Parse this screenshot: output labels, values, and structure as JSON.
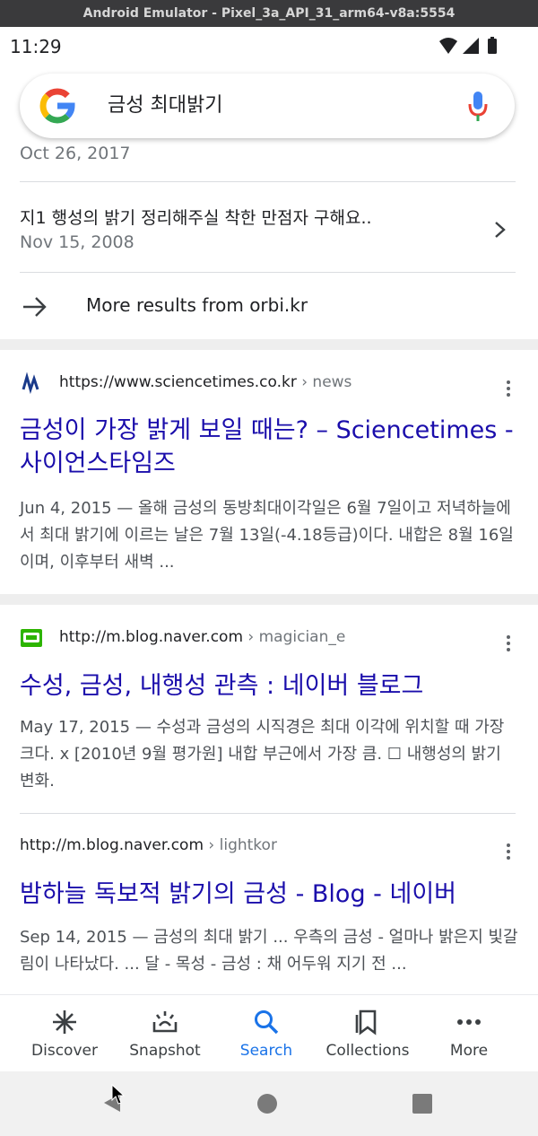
{
  "window": {
    "title": "Android Emulator - Pixel_3a_API_31_arm64-v8a:5554"
  },
  "status": {
    "time": "11:29"
  },
  "search": {
    "query": "금성 최대밝기"
  },
  "orbi": {
    "top_date": "Oct 26, 2017",
    "sub_title": "지1 행성의 밝기 정리해주실 착한 만점자 구해요..",
    "sub_date": "Nov 15, 2008",
    "more_results": "More results from orbi.kr"
  },
  "results": [
    {
      "url": "https://www.sciencetimes.co.kr",
      "crumb": " › news",
      "title": "금성이 가장 밝게 보일 때는? – Sciencetimes - 사이언스타임즈",
      "snippet": "Jun 4, 2015 — 올해 금성의 동방최대이각일은 6월 7일이고 저녁하늘에서 최대 밝기에 이르는 날은 7월 13일(-4.18등급)이다. 내합은 8월 16일이며, 이후부터 새벽 ..."
    },
    {
      "url": "http://m.blog.naver.com",
      "crumb": " › magician_e",
      "title": "수성, 금성, 내행성 관측 : 네이버 블로그",
      "snippet": "May 17, 2015 — 수성과 금성의 시직경은 최대 이각에 위치할 때 가장 크다. x [2010년 9월 평가원] 내합 부근에서 가장 큼. ☐ 내행성의 밝기 변화."
    },
    {
      "url": "http://m.blog.naver.com",
      "crumb": " › lightkor",
      "title": "밤하늘 독보적 밝기의 금성 - Blog - 네이버",
      "snippet": "Sep 14, 2015 — 금성의 최대 밝기 ... 우측의 금성 - 얼마나 밝은지 빛갈림이 나타났다. ... 달 - 목성 - 금성 : 채 어두워 지기 전 ..."
    }
  ],
  "nav": {
    "items": [
      {
        "label": "Discover",
        "icon": "discover-icon"
      },
      {
        "label": "Snapshot",
        "icon": "snapshot-icon"
      },
      {
        "label": "Search",
        "icon": "search-icon"
      },
      {
        "label": "Collections",
        "icon": "collections-icon"
      },
      {
        "label": "More",
        "icon": "more-icon"
      }
    ],
    "active": "Search"
  },
  "colors": {
    "link": "#1a0dab",
    "active": "#1a73e8",
    "text": "#202124",
    "muted": "#70757a"
  }
}
